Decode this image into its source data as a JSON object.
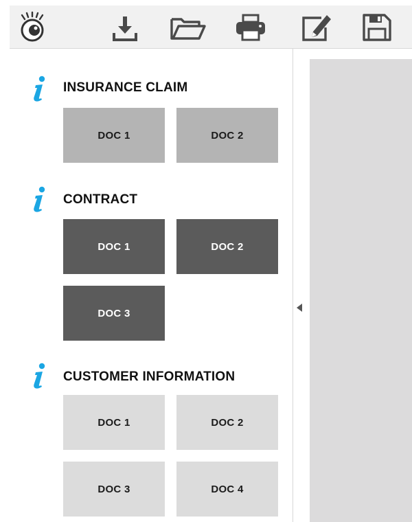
{
  "toolbar": {
    "buttons": [
      {
        "name": "view",
        "icon": "eye-icon"
      },
      {
        "name": "download",
        "icon": "download-icon"
      },
      {
        "name": "open",
        "icon": "folder-open-icon"
      },
      {
        "name": "print",
        "icon": "printer-icon"
      },
      {
        "name": "edit",
        "icon": "edit-icon"
      },
      {
        "name": "save",
        "icon": "save-icon"
      }
    ]
  },
  "sections": [
    {
      "title": "INSURANCE CLAIM",
      "docs": [
        "DOC 1",
        "DOC 2"
      ]
    },
    {
      "title": "CONTRACT",
      "docs": [
        "DOC 1",
        "DOC 2",
        "DOC 3"
      ]
    },
    {
      "title": "CUSTOMER INFORMATION",
      "docs": [
        "DOC 1",
        "DOC 2",
        "DOC 3",
        "DOC 4"
      ]
    }
  ],
  "colors": {
    "info_icon": "#1ba6e3",
    "claim_tile": "#b4b4b4",
    "contract_tile": "#5b5b5b",
    "customer_tile": "#dcdcdc",
    "right_panel": "#dcdbdc"
  }
}
